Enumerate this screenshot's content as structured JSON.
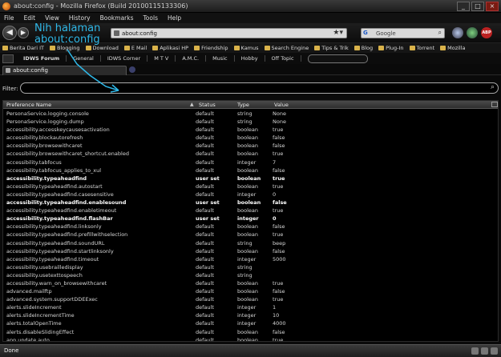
{
  "window": {
    "title": "about:config - Mozilla Firefox (Build 20100115133306)"
  },
  "menu": [
    "File",
    "Edit",
    "View",
    "History",
    "Bookmarks",
    "Tools",
    "Help"
  ],
  "nav": {
    "url": "about:config",
    "search_placeholder": "Google"
  },
  "bookmarks": [
    "Berita Dari IT",
    "Blogging",
    "Download",
    "E Mail",
    "Aplikasi HP",
    "Friendship",
    "Kamus",
    "Search Engine",
    "Tips & Trik",
    "Blog",
    "Plug-In",
    "Torrent",
    "Mozilla"
  ],
  "custom_toolbar": [
    "IDWS Forum",
    "General",
    "IDWS Corner",
    "M T V",
    "A.M.C.",
    "Music",
    "Hobby",
    "Off Topic"
  ],
  "tab": {
    "label": "about:config"
  },
  "filter": {
    "label": "Filter:"
  },
  "table": {
    "columns": [
      "Preference Name",
      "Status",
      "Type",
      "Value"
    ],
    "rows": [
      {
        "name": "PersonaService.logging.console",
        "status": "default",
        "type": "string",
        "value": "None",
        "bold": false
      },
      {
        "name": "PersonaService.logging.dump",
        "status": "default",
        "type": "string",
        "value": "None",
        "bold": false
      },
      {
        "name": "accessibility.accesskeycausesactivation",
        "status": "default",
        "type": "boolean",
        "value": "true",
        "bold": false
      },
      {
        "name": "accessibility.blockautorefresh",
        "status": "default",
        "type": "boolean",
        "value": "false",
        "bold": false
      },
      {
        "name": "accessibility.browsewithcaret",
        "status": "default",
        "type": "boolean",
        "value": "false",
        "bold": false
      },
      {
        "name": "accessibility.browsewithcaret_shortcut.enabled",
        "status": "default",
        "type": "boolean",
        "value": "true",
        "bold": false
      },
      {
        "name": "accessibility.tabfocus",
        "status": "default",
        "type": "integer",
        "value": "7",
        "bold": false
      },
      {
        "name": "accessibility.tabfocus_applies_to_xul",
        "status": "default",
        "type": "boolean",
        "value": "false",
        "bold": false
      },
      {
        "name": "accessibility.typeaheadfind",
        "status": "user set",
        "type": "boolean",
        "value": "true",
        "bold": true
      },
      {
        "name": "accessibility.typeaheadfind.autostart",
        "status": "default",
        "type": "boolean",
        "value": "true",
        "bold": false
      },
      {
        "name": "accessibility.typeaheadfind.casesensitive",
        "status": "default",
        "type": "integer",
        "value": "0",
        "bold": false
      },
      {
        "name": "accessibility.typeaheadfind.enablesound",
        "status": "user set",
        "type": "boolean",
        "value": "false",
        "bold": true
      },
      {
        "name": "accessibility.typeaheadfind.enabletimeout",
        "status": "default",
        "type": "boolean",
        "value": "true",
        "bold": false
      },
      {
        "name": "accessibility.typeaheadfind.flashBar",
        "status": "user set",
        "type": "integer",
        "value": "0",
        "bold": true
      },
      {
        "name": "accessibility.typeaheadfind.linksonly",
        "status": "default",
        "type": "boolean",
        "value": "false",
        "bold": false
      },
      {
        "name": "accessibility.typeaheadfind.prefillwithselection",
        "status": "default",
        "type": "boolean",
        "value": "true",
        "bold": false
      },
      {
        "name": "accessibility.typeaheadfind.soundURL",
        "status": "default",
        "type": "string",
        "value": "beep",
        "bold": false
      },
      {
        "name": "accessibility.typeaheadfind.startlinksonly",
        "status": "default",
        "type": "boolean",
        "value": "false",
        "bold": false
      },
      {
        "name": "accessibility.typeaheadfind.timeout",
        "status": "default",
        "type": "integer",
        "value": "5000",
        "bold": false
      },
      {
        "name": "accessibility.usebrailledisplay",
        "status": "default",
        "type": "string",
        "value": "",
        "bold": false
      },
      {
        "name": "accessibility.usetexttospeech",
        "status": "default",
        "type": "string",
        "value": "",
        "bold": false
      },
      {
        "name": "accessibility.warn_on_browsewithcaret",
        "status": "default",
        "type": "boolean",
        "value": "true",
        "bold": false
      },
      {
        "name": "advanced.mailftp",
        "status": "default",
        "type": "boolean",
        "value": "false",
        "bold": false
      },
      {
        "name": "advanced.system.supportDDEExec",
        "status": "default",
        "type": "boolean",
        "value": "true",
        "bold": false
      },
      {
        "name": "alerts.slideIncrement",
        "status": "default",
        "type": "integer",
        "value": "1",
        "bold": false
      },
      {
        "name": "alerts.slideIncrementTime",
        "status": "default",
        "type": "integer",
        "value": "10",
        "bold": false
      },
      {
        "name": "alerts.totalOpenTime",
        "status": "default",
        "type": "integer",
        "value": "4000",
        "bold": false
      },
      {
        "name": "alerts.disableSlidingEffect",
        "status": "default",
        "type": "boolean",
        "value": "false",
        "bold": false
      },
      {
        "name": "app.update.auto",
        "status": "default",
        "type": "boolean",
        "value": "true",
        "bold": false
      }
    ]
  },
  "annotation": {
    "line1": "Nih halaman",
    "line2": "about:config"
  },
  "status": {
    "text": "Done"
  },
  "colors": {
    "annotation": "#2fb8e8",
    "background": "#000000"
  }
}
